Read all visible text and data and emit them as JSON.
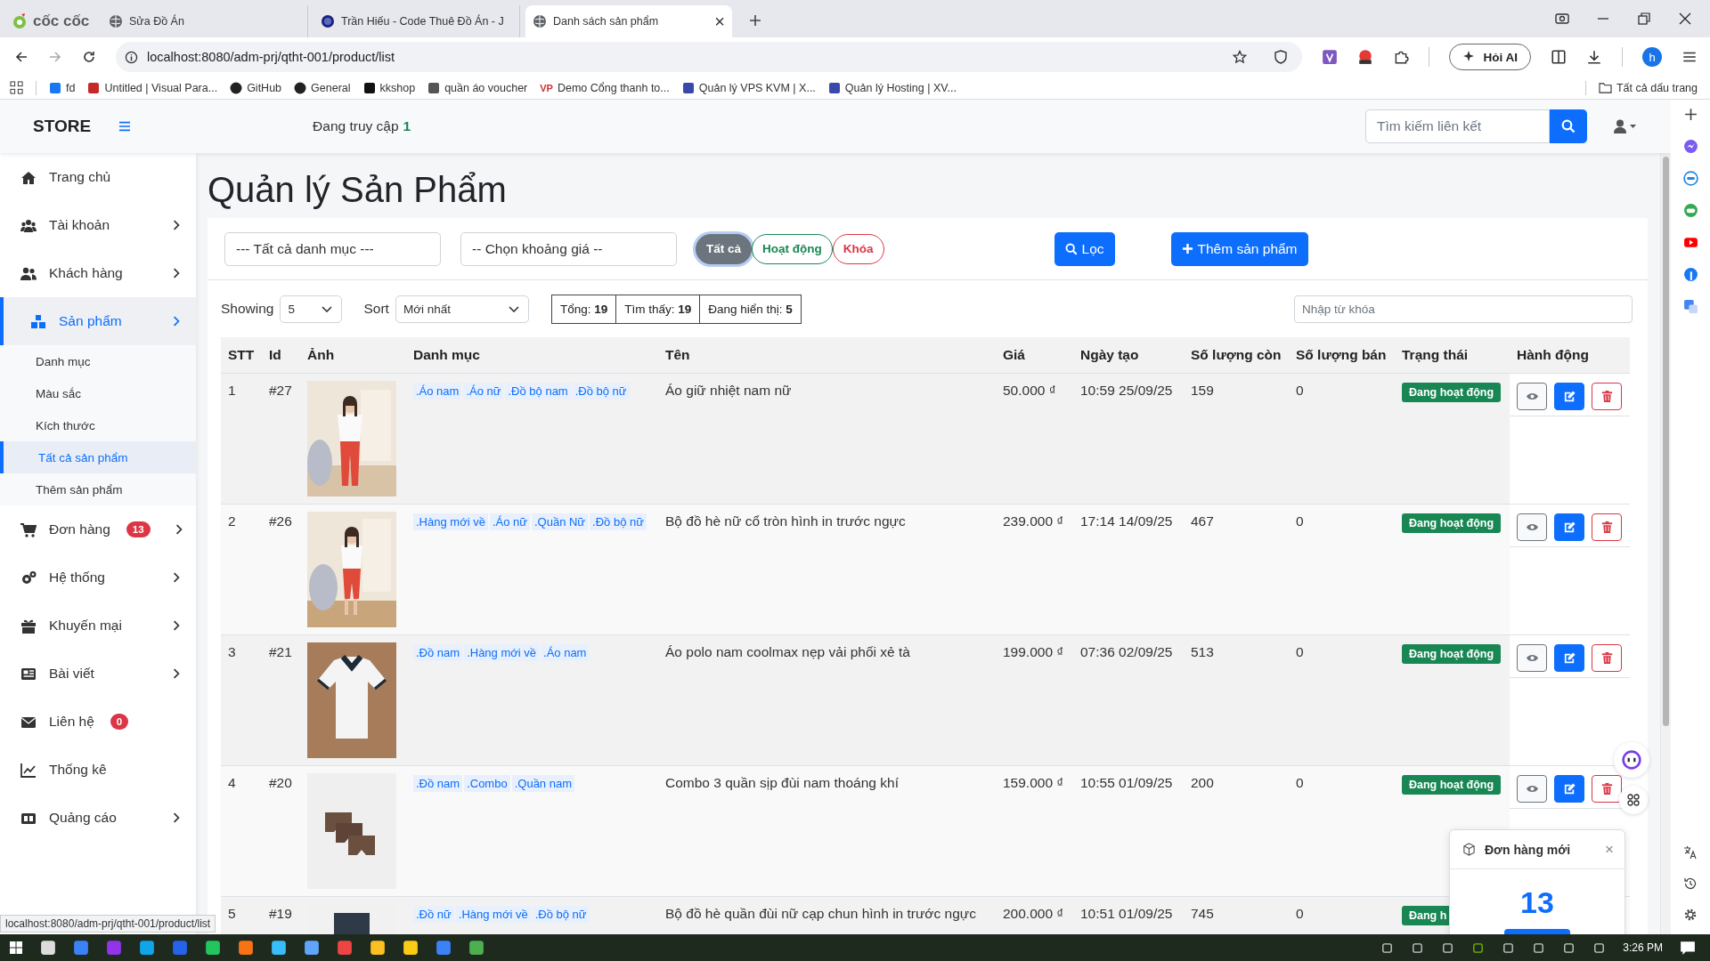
{
  "browser": {
    "logo": "cốc cốc",
    "tabs": [
      {
        "title": "Sửa Đồ Án",
        "selected": false
      },
      {
        "title": "Trần Hiếu - Code Thuê Đồ Án - J",
        "selected": false
      },
      {
        "title": "Danh sách sản phẩm",
        "selected": true
      }
    ],
    "close": "×",
    "url": "localhost:8080/adm-prj/qtht-001/product/list",
    "ai_button": "Hỏi AI",
    "profile": "h",
    "bookmarks": [
      {
        "label": "fd"
      },
      {
        "label": "Untitled | Visual Para..."
      },
      {
        "label": "GitHub"
      },
      {
        "label": "General"
      },
      {
        "label": "kkshop"
      },
      {
        "label": "quần áo voucher"
      },
      {
        "label": "Demo Cổng thanh to...",
        "icon_text": "VP"
      },
      {
        "label": "Quản lý VPS KVM | X..."
      },
      {
        "label": "Quản lý Hosting | XV..."
      }
    ],
    "all_bookmarks": "Tất cả dấu trang"
  },
  "app": {
    "brand": "STORE",
    "online_label": "Đang truy cập",
    "online_count": "1",
    "search_placeholder": "Tìm kiếm liên kết"
  },
  "sidebar": [
    {
      "label": "Trang chủ",
      "has_submenu": false,
      "selected": false
    },
    {
      "label": "Tài khoản",
      "has_submenu": true,
      "selected": false,
      "expanded": false
    },
    {
      "label": "Khách hàng",
      "has_submenu": true,
      "selected": false,
      "expanded": false
    },
    {
      "label": "Sản phẩm",
      "has_submenu": true,
      "selected": true,
      "expanded": true,
      "children": [
        {
          "label": "Danh mục",
          "selected": false
        },
        {
          "label": "Màu sắc",
          "selected": false
        },
        {
          "label": "Kích thước",
          "selected": false
        },
        {
          "label": "Tất cả sản phẩm",
          "selected": true
        },
        {
          "label": "Thêm sản phẩm",
          "selected": false
        }
      ]
    },
    {
      "label": "Đơn hàng",
      "badge": "13",
      "has_submenu": true,
      "selected": false,
      "expanded": false
    },
    {
      "label": "Hệ thống",
      "has_submenu": true,
      "selected": false,
      "expanded": false
    },
    {
      "label": "Khuyến mại",
      "has_submenu": true,
      "selected": false,
      "expanded": false
    },
    {
      "label": "Bài viết",
      "has_submenu": true,
      "selected": false,
      "expanded": false
    },
    {
      "label": "Liên hệ",
      "badge": "0",
      "has_submenu": false,
      "selected": false
    },
    {
      "label": "Thống kê",
      "has_submenu": false,
      "selected": false
    },
    {
      "label": "Quảng cáo",
      "has_submenu": true,
      "selected": false,
      "expanded": false
    }
  ],
  "page": {
    "title": "Quản lý Sản Phẩm",
    "filters": {
      "category": "--- Tất cả danh mục ---",
      "price": "-- Chọn khoảng giá --",
      "status_options": [
        {
          "label": "Tất cả",
          "kind": "all",
          "selected": true
        },
        {
          "label": "Hoạt động",
          "kind": "active",
          "selected": false
        },
        {
          "label": "Khóa",
          "kind": "locked",
          "selected": false
        }
      ],
      "filter_button": "Lọc",
      "add_button": "Thêm sản phẩm"
    },
    "toolbar": {
      "showing_label": "Showing",
      "per_page_option": "5",
      "sort_label": "Sort",
      "sort": "Mới nhất",
      "stats": [
        "Tổng: **19**",
        "Tìm thấy: **19**",
        "Đang hiển thị: **5**"
      ],
      "keyword_placeholder": "Nhập từ khóa"
    },
    "table": {
      "columns": [
        "STT",
        "Id",
        "Ảnh",
        "Danh mục",
        "Tên",
        "Giá",
        "Ngày tạo",
        "Số lượng còn",
        "Số lượng bán",
        "Trạng thái",
        "Hành động"
      ],
      "rows": [
        {
          "stt": "1",
          "id": "#27",
          "categories": [
            ".Áo nam",
            ".Áo nữ",
            ".Đồ bộ nam",
            ".Đồ bộ nữ"
          ],
          "name": "Áo giữ nhiệt nam nữ",
          "price": "50.000 ₫",
          "created": "10:59 25/09/25",
          "stock": "159",
          "sold": "0",
          "status": {
            "text": "Đang hoạt động",
            "active": true
          },
          "actions": [
            {
              "kind": "view"
            },
            {
              "kind": "edit"
            },
            {
              "kind": "delete"
            }
          ]
        },
        {
          "stt": "2",
          "id": "#26",
          "categories": [
            ".Hàng mới về",
            ".Áo nữ",
            ".Quần Nữ",
            ".Đồ bộ nữ"
          ],
          "name": "Bộ đồ hè nữ cổ tròn hình in trước ngực",
          "price": "239.000 ₫",
          "created": "17:14 14/09/25",
          "stock": "467",
          "sold": "0",
          "status": {
            "text": "Đang hoạt động",
            "active": true
          },
          "actions": [
            {
              "kind": "view"
            },
            {
              "kind": "edit"
            },
            {
              "kind": "delete"
            }
          ]
        },
        {
          "stt": "3",
          "id": "#21",
          "categories": [
            ".Đồ nam",
            ".Hàng mới về",
            ".Áo nam"
          ],
          "name": "Áo polo nam coolmax nẹp vải phối xẻ tà",
          "price": "199.000 ₫",
          "created": "07:36 02/09/25",
          "stock": "513",
          "sold": "0",
          "status": {
            "text": "Đang hoạt động",
            "active": true
          },
          "actions": [
            {
              "kind": "view"
            },
            {
              "kind": "edit"
            },
            {
              "kind": "delete"
            }
          ]
        },
        {
          "stt": "4",
          "id": "#20",
          "categories": [
            ".Đồ nam",
            ".Combo",
            ".Quần nam"
          ],
          "name": "Combo 3 quần sịp đùi nam thoáng khí",
          "price": "159.000 ₫",
          "created": "10:55 01/09/25",
          "stock": "200",
          "sold": "0",
          "status": {
            "text": "Đang hoạt động",
            "active": true
          },
          "actions": [
            {
              "kind": "view"
            },
            {
              "kind": "edit"
            },
            {
              "kind": "delete"
            }
          ]
        },
        {
          "stt": "5",
          "id": "#19",
          "categories": [
            ".Đồ nữ",
            ".Hàng mới về",
            ".Đồ bộ nữ"
          ],
          "name": "Bộ đồ hè quần đùi nữ cạp chun hình in trước ngực",
          "price": "200.000 ₫",
          "created": "10:51 01/09/25",
          "stock": "745",
          "sold": "0",
          "status": {
            "text": "Đang h",
            "active": true
          }
        }
      ]
    }
  },
  "toast": {
    "title": "Đơn hàng mới",
    "close": "×",
    "count": "13"
  },
  "status_tooltip": "localhost:8080/adm-prj/qtht-001/product/list",
  "taskbar": {
    "time": "3:26 PM"
  }
}
